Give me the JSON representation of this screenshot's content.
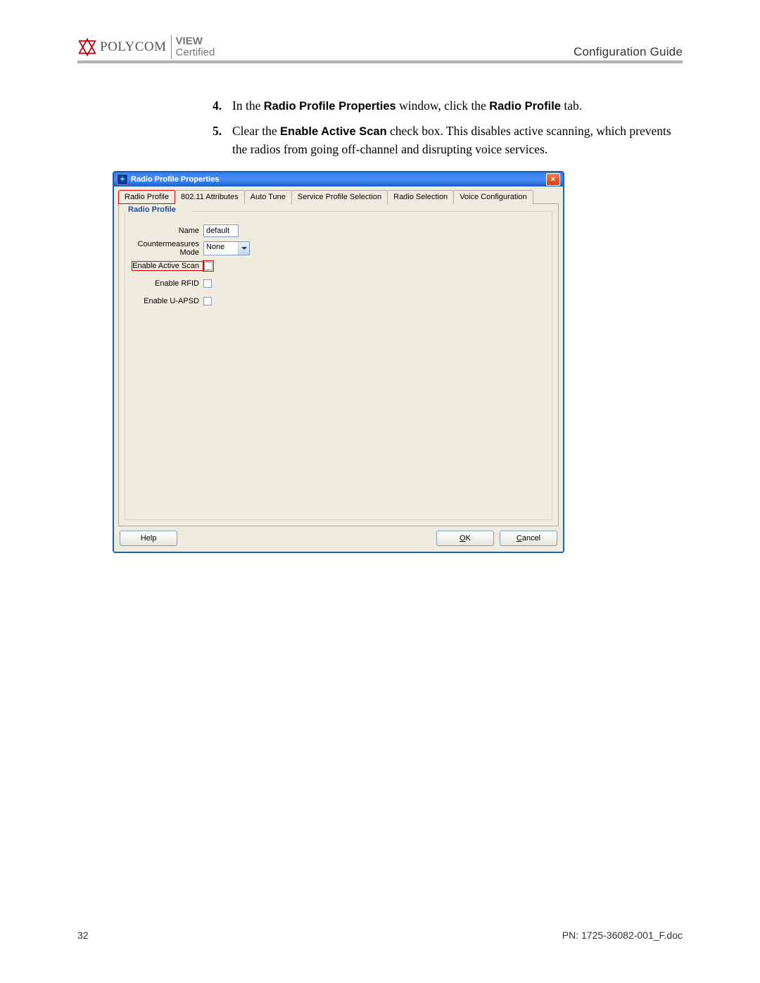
{
  "header": {
    "brand_text": "POLYCOM",
    "view_line1": "VIEW",
    "view_line2": "Certified",
    "guide_title": "Configuration Guide"
  },
  "instructions": [
    {
      "num": "4.",
      "prefix": "In the ",
      "bold1": "Radio Profile Properties",
      "mid": " window, click the ",
      "bold2": "Radio Profile",
      "suffix": " tab."
    },
    {
      "num": "5.",
      "prefix": "Clear the ",
      "bold1": "Enable Active Scan",
      "mid": " check box. This disables active scanning, which prevents the radios from going off-channel and disrupting voice services.",
      "bold2": "",
      "suffix": ""
    }
  ],
  "dialog": {
    "title": "Radio Profile Properties",
    "tabs": [
      "Radio Profile",
      "802.11 Attributes",
      "Auto Tune",
      "Service Profile Selection",
      "Radio Selection",
      "Voice Configuration"
    ],
    "groupbox_label": "Radio Profile",
    "name_label": "Name",
    "name_value": "default",
    "counter_label": "Countermeasures Mode",
    "counter_value": "None",
    "cb_scan": "Enable Active Scan",
    "cb_rfid": "Enable RFID",
    "cb_uapsd": "Enable U-APSD",
    "help": "Help",
    "ok_u": "O",
    "ok_rest": "K",
    "cancel_u": "C",
    "cancel_rest": "ancel"
  },
  "footer": {
    "page_num": "32",
    "doc_id": "PN: 1725-36082-001_F.doc"
  }
}
